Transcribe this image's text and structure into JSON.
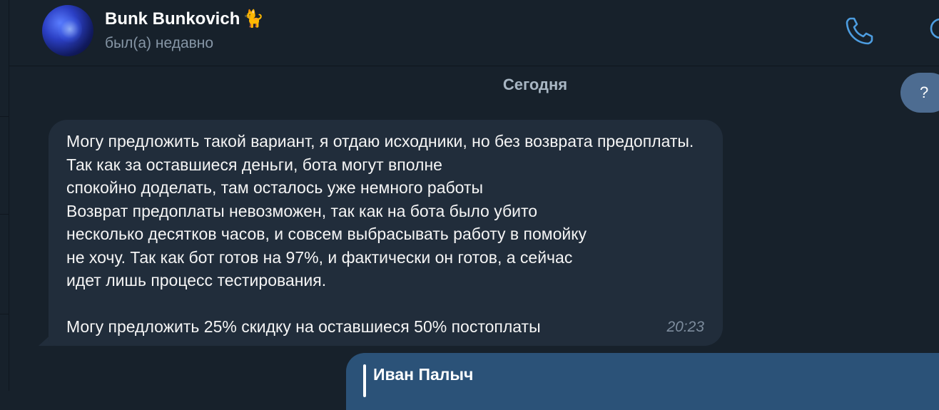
{
  "header": {
    "contact_name": "Bunk Bunkovich",
    "contact_emoji": "🐈",
    "status": "был(а) недавно",
    "call_icon": "phone-icon",
    "search_icon": "search-icon"
  },
  "chat": {
    "date_label": "Сегодня",
    "help_label": "?",
    "incoming_message": {
      "text": "Могу предложить такой вариант, я отдаю исходники, но без возврата предоплаты. Так как за оставшиеся деньги, бота могут вполне\nспокойно доделать, там осталось уже немного работы\nВозврат предоплаты  невозможен, так как на бота было убито\nнесколько десятков часов, и совсем выбрасывать работу в помойку\nне хочу. Так как бот готов на 97%, и фактически он готов, а сейчас\nидет лишь процесс тестирования.\n\nМогу предложить 25% скидку на оставшиеся 50% постоплаты",
      "time": "20:23"
    },
    "outgoing_message": {
      "reply_to_name": "Иван Палыч"
    }
  },
  "colors": {
    "background": "#17212b",
    "incoming_bubble": "#212d3b",
    "outgoing_bubble": "#2b5278",
    "accent": "#4d9de0"
  }
}
